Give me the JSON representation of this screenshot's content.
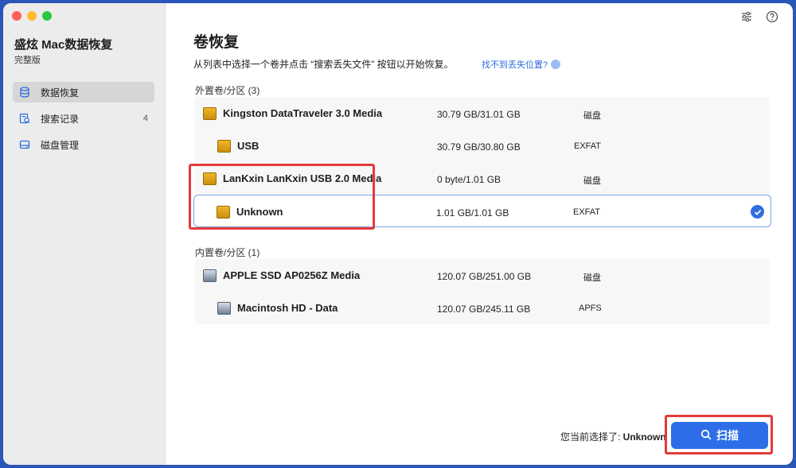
{
  "sidebar": {
    "app_title": "盛炫 Mac数据恢复",
    "edition": "完整版",
    "items": [
      {
        "label": "数据恢复",
        "icon": "database-icon",
        "active": true
      },
      {
        "label": "搜索记录",
        "icon": "search-history-icon",
        "badge": "4"
      },
      {
        "label": "磁盘管理",
        "icon": "disk-management-icon"
      }
    ]
  },
  "header": {
    "title": "卷恢复",
    "instruction": "从列表中选择一个卷并点击 “搜索丢失文件” 按钮以开始恢复。",
    "help_link": "找不到丢失位置?"
  },
  "external": {
    "label": "外置卷/分区 (3)",
    "rows": [
      {
        "name": "Kingston DataTraveler 3.0 Media",
        "size": "30.79 GB/31.01 GB",
        "type": "磁盘",
        "level": 0
      },
      {
        "name": "USB",
        "size": "30.79 GB/30.80 GB",
        "type": "EXFAT",
        "level": 1
      },
      {
        "name": "LanKxin LanKxin USB 2.0 Media",
        "size": "0 byte/1.01 GB",
        "type": "磁盘",
        "level": 0
      },
      {
        "name": "Unknown",
        "size": "1.01 GB/1.01 GB",
        "type": "EXFAT",
        "level": 1,
        "selected": true
      }
    ]
  },
  "internal": {
    "label": "内置卷/分区 (1)",
    "rows": [
      {
        "name": "APPLE SSD AP0256Z Media",
        "size": "120.07 GB/251.00 GB",
        "type": "磁盘",
        "level": 0
      },
      {
        "name": "Macintosh HD - Data",
        "size": "120.07 GB/245.11 GB",
        "type": "APFS",
        "level": 1
      }
    ]
  },
  "footer": {
    "status_prefix": "您当前选择了: ",
    "status_value": "Unknown",
    "scan_label": "扫描"
  },
  "colors": {
    "accent": "#2d6ee8",
    "highlight_box": "#e33b3b",
    "selected_border": "#7aa3ec"
  }
}
